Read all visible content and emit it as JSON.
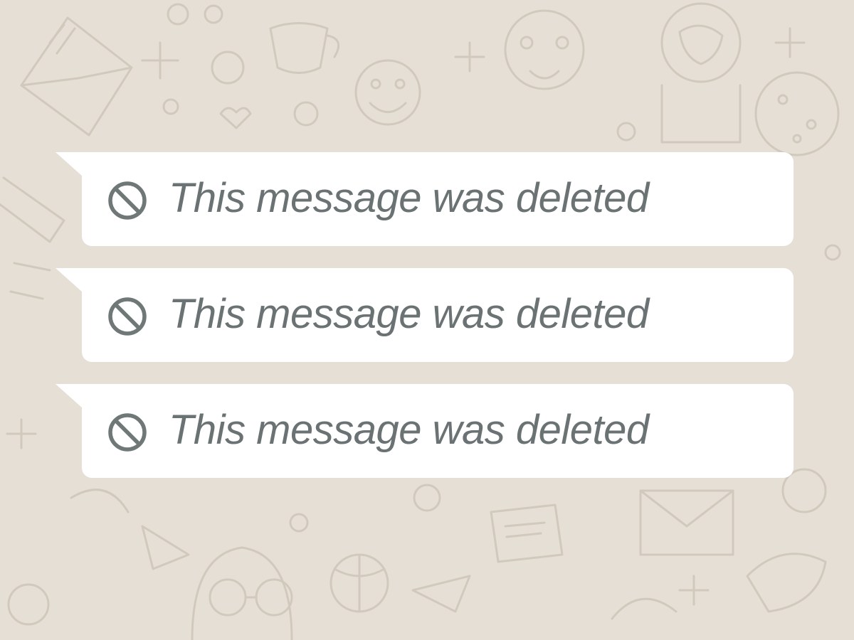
{
  "chat": {
    "background_color": "#e6dfd6",
    "bubble_color": "#ffffff",
    "text_color": "#6b7273",
    "messages": [
      {
        "icon": "ban-icon",
        "text": "This message was deleted"
      },
      {
        "icon": "ban-icon",
        "text": "This message was deleted"
      },
      {
        "icon": "ban-icon",
        "text": "This message was deleted"
      }
    ]
  }
}
